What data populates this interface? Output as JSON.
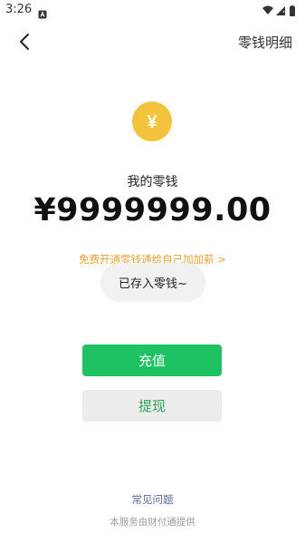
{
  "status_bar": {
    "time": "3:26",
    "notification_icon": "a-square-icon",
    "wifi_icon": "wifi-icon",
    "signal_icon": "signal-icon",
    "battery_icon": "battery-icon"
  },
  "nav": {
    "back_icon": "chevron-left-icon",
    "title_right": "零钱明细"
  },
  "balance": {
    "coin_icon": "yen-coin-icon",
    "coin_symbol": "¥",
    "label": "我的零钱",
    "amount": "¥9999999.00"
  },
  "promo": {
    "text": "免费开通零钱通给自己加加薪 >"
  },
  "toast": {
    "text": "已存入零钱~"
  },
  "actions": {
    "recharge_label": "充值",
    "withdraw_label": "提现"
  },
  "footer": {
    "faq_label": "常见问题",
    "provider_note": "本服务由财付通提供"
  },
  "colors": {
    "accent_green": "#1fc263",
    "coin_yellow": "#f3c33c",
    "promo_orange": "#e7a33b",
    "link_blue": "#576b95"
  }
}
